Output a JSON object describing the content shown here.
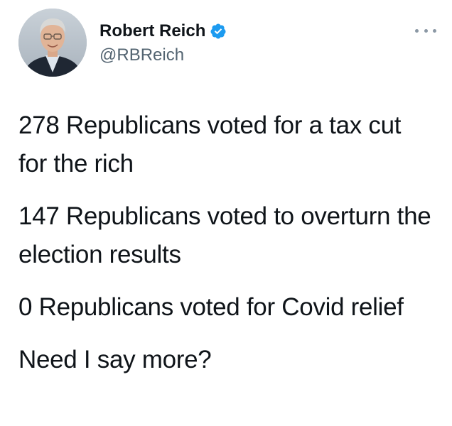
{
  "author": {
    "display_name": "Robert Reich",
    "handle": "@RBReich",
    "verified": true,
    "avatar_icon": "avatar-photo"
  },
  "menu": {
    "icon": "more-options-icon"
  },
  "tweet": {
    "paragraphs": [
      "278 Republicans voted for a tax cut for the rich",
      "147 Republicans voted to overturn the election results",
      "0 Republicans voted for Covid relief",
      "Need I say more?"
    ]
  },
  "colors": {
    "verified": "#1d9bf0",
    "text": "#0f1419",
    "secondary": "#536471"
  }
}
